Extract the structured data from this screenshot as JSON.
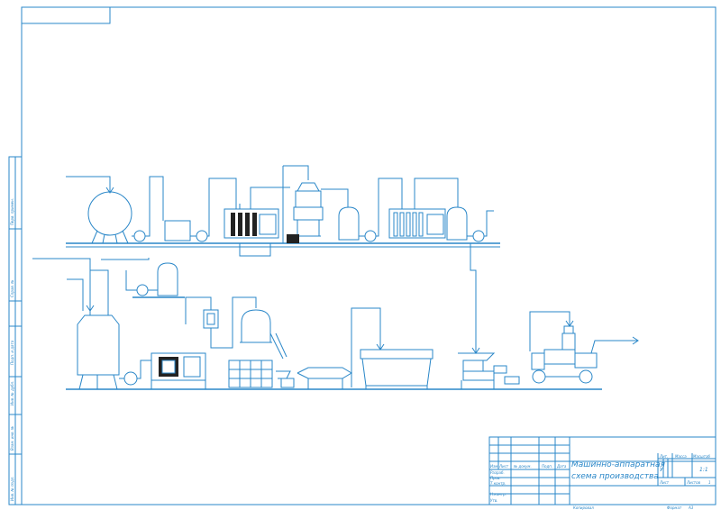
{
  "title_block": {
    "title_line1": "Машинно-аппаратная",
    "title_line2": "схема производства",
    "col_izm": "Изм.",
    "col_list": "Лист",
    "col_doc": "№ докум.",
    "col_sign": "Подп.",
    "col_date": "Дата",
    "role_dev": "Разраб.",
    "role_check": "Пров.",
    "role_tcontrol": "Т.контр.",
    "role_ncontrol": "Н.контр.",
    "role_approve": "Утв.",
    "lit_label": "Лит.",
    "mass_label": "Масса",
    "scale_label": "Масштаб",
    "lit_value": "У",
    "scale_value": "1:1",
    "sheet_label": "Лист",
    "sheets_label": "Листов",
    "sheets_value": "1",
    "copied_label": "Копировал",
    "format_label": "Формат",
    "format_value": "А3"
  },
  "side_stamp": {
    "labels": [
      "Перв. примен.",
      "Справ. №",
      "Подп. и дата",
      "Инв. № дубл.",
      "Взам. инв. №",
      "Подп. и дата",
      "Инв. № подл."
    ]
  }
}
